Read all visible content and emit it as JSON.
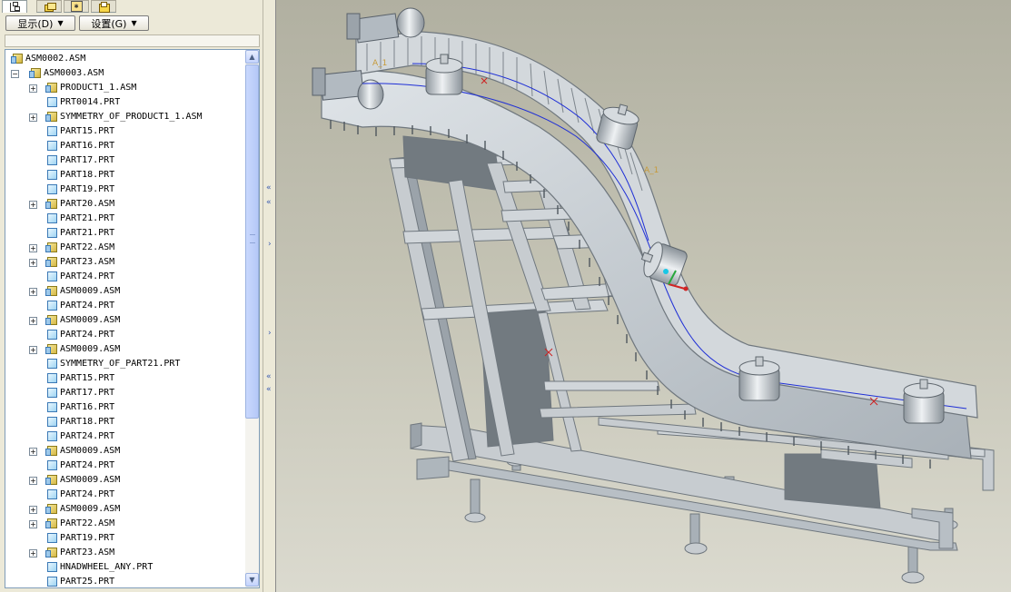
{
  "panel_tabs": [
    {
      "name": "model-tree",
      "icon": "model-tree-icon"
    },
    {
      "name": "layers",
      "icon": "layers-icon"
    },
    {
      "name": "favorites",
      "icon": "favorites-icon"
    },
    {
      "name": "folder",
      "icon": "folder-icon"
    }
  ],
  "toolbar": {
    "display_label": "显示(D)",
    "settings_label": "设置(G)"
  },
  "tree": {
    "items": [
      {
        "label": "ASM0002.ASM",
        "type": "asm",
        "level": 0,
        "expander": ""
      },
      {
        "label": "ASM0003.ASM",
        "type": "asm",
        "level": 1,
        "expander": "−"
      },
      {
        "label": "PRODUCT1_1.ASM",
        "type": "asm",
        "level": 2,
        "expander": "+"
      },
      {
        "label": "PRT0014.PRT",
        "type": "prt",
        "level": 2,
        "expander": ""
      },
      {
        "label": "SYMMETRY_OF_PRODUCT1_1.ASM",
        "type": "asm",
        "level": 2,
        "expander": "+"
      },
      {
        "label": "PART15.PRT",
        "type": "prt",
        "level": 2,
        "expander": ""
      },
      {
        "label": "PART16.PRT",
        "type": "prt",
        "level": 2,
        "expander": ""
      },
      {
        "label": "PART17.PRT",
        "type": "prt",
        "level": 2,
        "expander": ""
      },
      {
        "label": "PART18.PRT",
        "type": "prt",
        "level": 2,
        "expander": ""
      },
      {
        "label": "PART19.PRT",
        "type": "prt",
        "level": 2,
        "expander": ""
      },
      {
        "label": "PART20.ASM",
        "type": "asm",
        "level": 2,
        "expander": "+"
      },
      {
        "label": "PART21.PRT",
        "type": "prt",
        "level": 2,
        "expander": ""
      },
      {
        "label": "PART21.PRT",
        "type": "prt",
        "level": 2,
        "expander": ""
      },
      {
        "label": "PART22.ASM",
        "type": "asm",
        "level": 2,
        "expander": "+"
      },
      {
        "label": "PART23.ASM",
        "type": "asm",
        "level": 2,
        "expander": "+"
      },
      {
        "label": "PART24.PRT",
        "type": "prt",
        "level": 2,
        "expander": ""
      },
      {
        "label": "ASM0009.ASM",
        "type": "asm",
        "level": 2,
        "expander": "+"
      },
      {
        "label": "PART24.PRT",
        "type": "prt",
        "level": 2,
        "expander": ""
      },
      {
        "label": "ASM0009.ASM",
        "type": "asm",
        "level": 2,
        "expander": "+"
      },
      {
        "label": "PART24.PRT",
        "type": "prt",
        "level": 2,
        "expander": ""
      },
      {
        "label": "ASM0009.ASM",
        "type": "asm",
        "level": 2,
        "expander": "+"
      },
      {
        "label": "SYMMETRY_OF_PART21.PRT",
        "type": "prt",
        "level": 2,
        "expander": ""
      },
      {
        "label": "PART15.PRT",
        "type": "prt",
        "level": 2,
        "expander": ""
      },
      {
        "label": "PART17.PRT",
        "type": "prt",
        "level": 2,
        "expander": ""
      },
      {
        "label": "PART16.PRT",
        "type": "prt",
        "level": 2,
        "expander": ""
      },
      {
        "label": "PART18.PRT",
        "type": "prt",
        "level": 2,
        "expander": ""
      },
      {
        "label": "PART24.PRT",
        "type": "prt",
        "level": 2,
        "expander": ""
      },
      {
        "label": "ASM0009.ASM",
        "type": "asm",
        "level": 2,
        "expander": "+"
      },
      {
        "label": "PART24.PRT",
        "type": "prt",
        "level": 2,
        "expander": ""
      },
      {
        "label": "ASM0009.ASM",
        "type": "asm",
        "level": 2,
        "expander": "+"
      },
      {
        "label": "PART24.PRT",
        "type": "prt",
        "level": 2,
        "expander": ""
      },
      {
        "label": "ASM0009.ASM",
        "type": "asm",
        "level": 2,
        "expander": "+"
      },
      {
        "label": "PART22.ASM",
        "type": "asm",
        "level": 2,
        "expander": "+"
      },
      {
        "label": "PART19.PRT",
        "type": "prt",
        "level": 2,
        "expander": ""
      },
      {
        "label": "PART23.ASM",
        "type": "asm",
        "level": 2,
        "expander": "+"
      },
      {
        "label": "HNADWHEEL_ANY.PRT",
        "type": "prt",
        "level": 2,
        "expander": ""
      },
      {
        "label": "PART25.PRT",
        "type": "prt",
        "level": 2,
        "expander": ""
      }
    ]
  },
  "viewport": {
    "model": "s-curve-conveyor-assembly",
    "background_top": "#b1b0a1",
    "background_bottom": "#dbdacf",
    "frame_color": "#c7ccd0",
    "frame_shade": "#8f979e",
    "dark_panel": "#727a80",
    "trajectory_color": "#1f2fd6",
    "marker_color": "#cc2222",
    "datum_label_color": "#c79a3a"
  },
  "scrollbar": {
    "up_icon": "▲",
    "down_icon": "▼"
  },
  "splitter": {
    "arrow_left": "«",
    "arrow_right": "›"
  }
}
